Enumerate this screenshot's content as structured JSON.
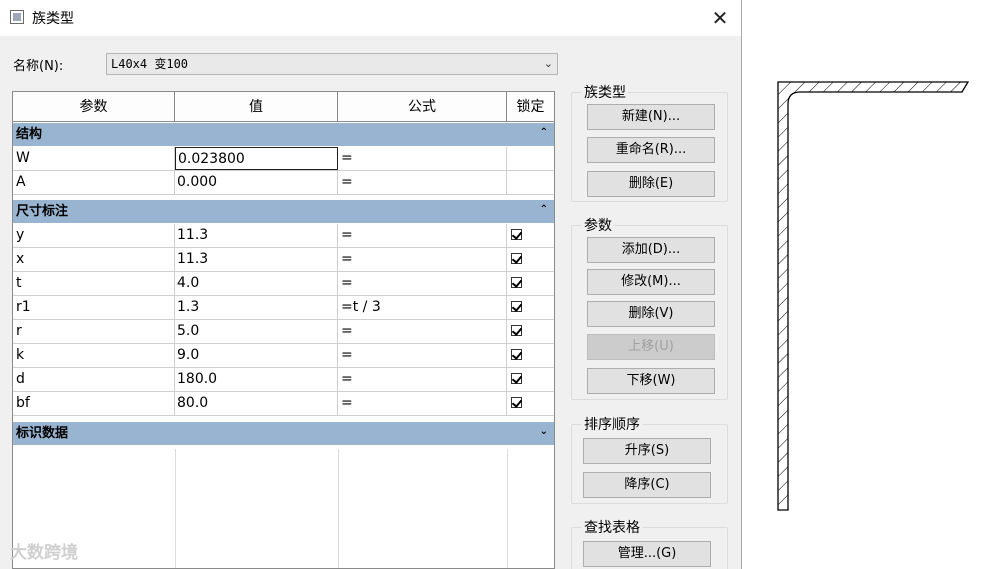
{
  "window": {
    "title": "族类型"
  },
  "name": {
    "label": "名称(N):",
    "value": "L40x4 变100"
  },
  "table": {
    "headers": [
      "参数",
      "值",
      "公式",
      "锁定"
    ],
    "groups": [
      {
        "label": "结构",
        "toggle": "⌃"
      },
      {
        "label": "尺寸标注",
        "toggle": "⌃"
      },
      {
        "label": "标识数据",
        "toggle": "⌄"
      }
    ],
    "structure_rows": [
      {
        "param": "W",
        "value": "0.023800",
        "formula": "=",
        "locked": false
      },
      {
        "param": "A",
        "value": "0.000",
        "formula": "=",
        "locked": false
      }
    ],
    "dimension_rows": [
      {
        "param": "y",
        "value": "11.3",
        "formula": "=",
        "locked": true
      },
      {
        "param": "x",
        "value": "11.3",
        "formula": "=",
        "locked": true
      },
      {
        "param": "t",
        "value": "4.0",
        "formula": "=",
        "locked": true
      },
      {
        "param": "r1",
        "value": "1.3",
        "formula": "=t / 3",
        "locked": true
      },
      {
        "param": "r",
        "value": "5.0",
        "formula": "=",
        "locked": true
      },
      {
        "param": "k",
        "value": "9.0",
        "formula": "=",
        "locked": true
      },
      {
        "param": "d",
        "value": "180.0",
        "formula": "=",
        "locked": true
      },
      {
        "param": "bf",
        "value": "80.0",
        "formula": "=",
        "locked": true
      }
    ]
  },
  "family_types": {
    "title": "族类型",
    "new": "新建(N)...",
    "rename": "重命名(R)...",
    "delete": "删除(E)"
  },
  "parameters": {
    "title": "参数",
    "add": "添加(D)...",
    "modify": "修改(M)...",
    "delete": "删除(V)",
    "move_up": "上移(U)",
    "move_down": "下移(W)"
  },
  "sort_order": {
    "title": "排序顺序",
    "ascending": "升序(S)",
    "descending": "降序(C)"
  },
  "lookup_tables": {
    "title": "查找表格",
    "manage": "管理...(G)"
  },
  "watermark": "大数跨境"
}
